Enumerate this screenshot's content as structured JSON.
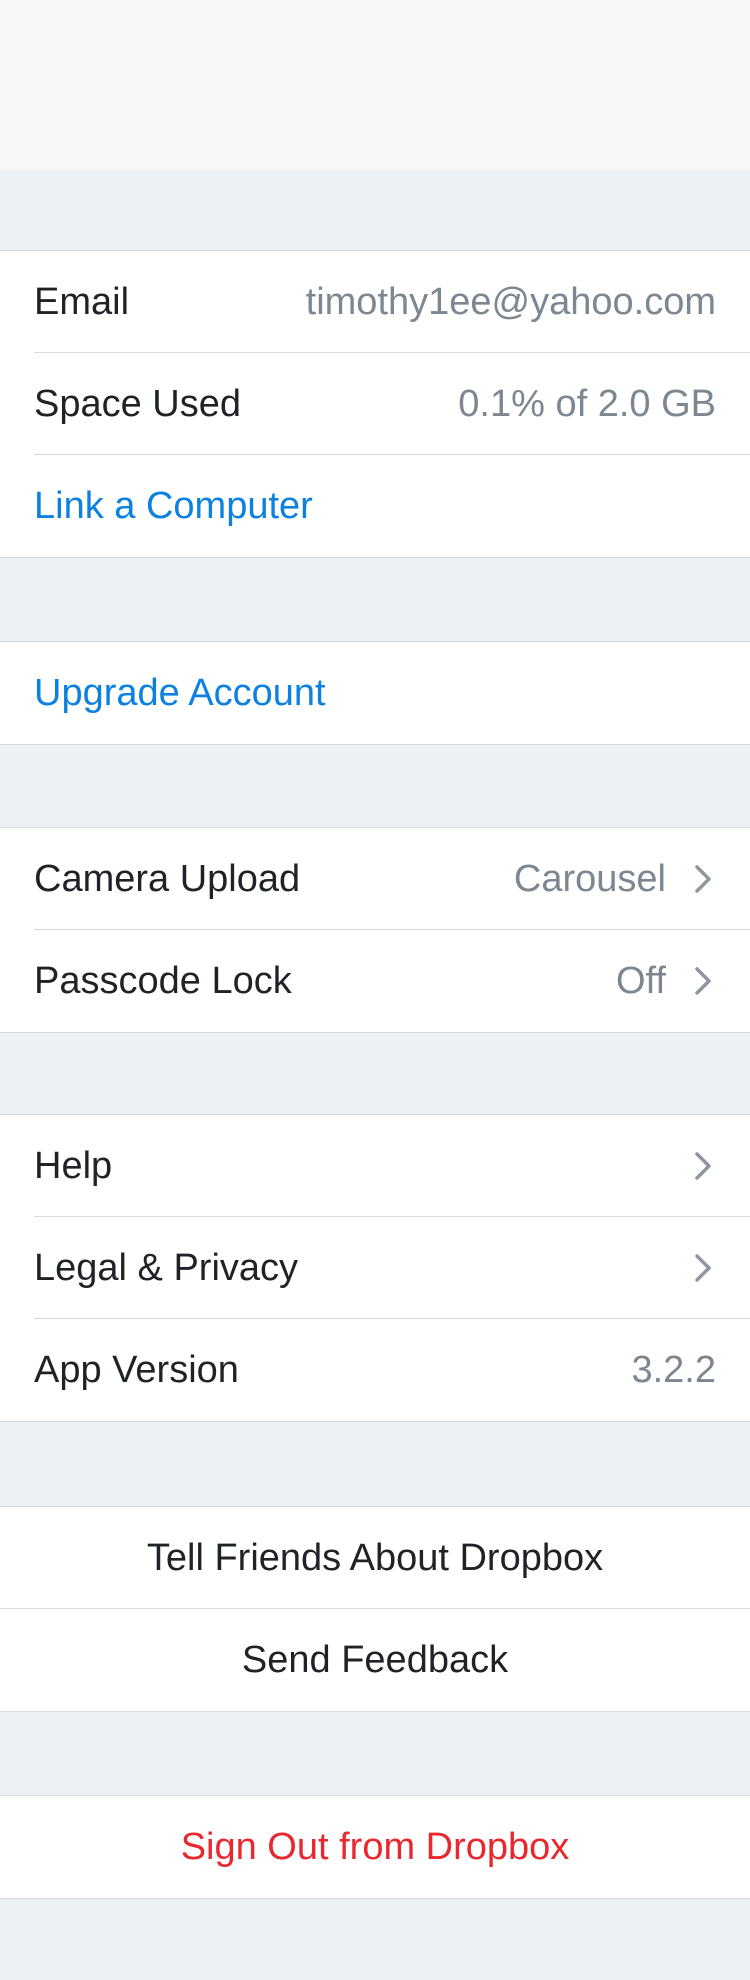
{
  "account": {
    "email_label": "Email",
    "email_value": "timothy1ee@yahoo.com",
    "space_label": "Space Used",
    "space_value": "0.1% of 2.0 GB",
    "link_computer": "Link a Computer"
  },
  "upgrade": {
    "label": "Upgrade Account"
  },
  "settings": {
    "camera_label": "Camera Upload",
    "camera_value": "Carousel",
    "passcode_label": "Passcode Lock",
    "passcode_value": "Off"
  },
  "info": {
    "help_label": "Help",
    "legal_label": "Legal & Privacy",
    "version_label": "App Version",
    "version_value": "3.2.2"
  },
  "share": {
    "tell_friends": "Tell Friends About Dropbox",
    "send_feedback": "Send Feedback"
  },
  "signout": {
    "label": "Sign Out from Dropbox"
  },
  "icons": {
    "chevron": "chevron-right-icon"
  },
  "colors": {
    "link": "#0d81e0",
    "danger": "#e8282e",
    "value_text": "#7c8791",
    "background": "#eef1f4"
  }
}
